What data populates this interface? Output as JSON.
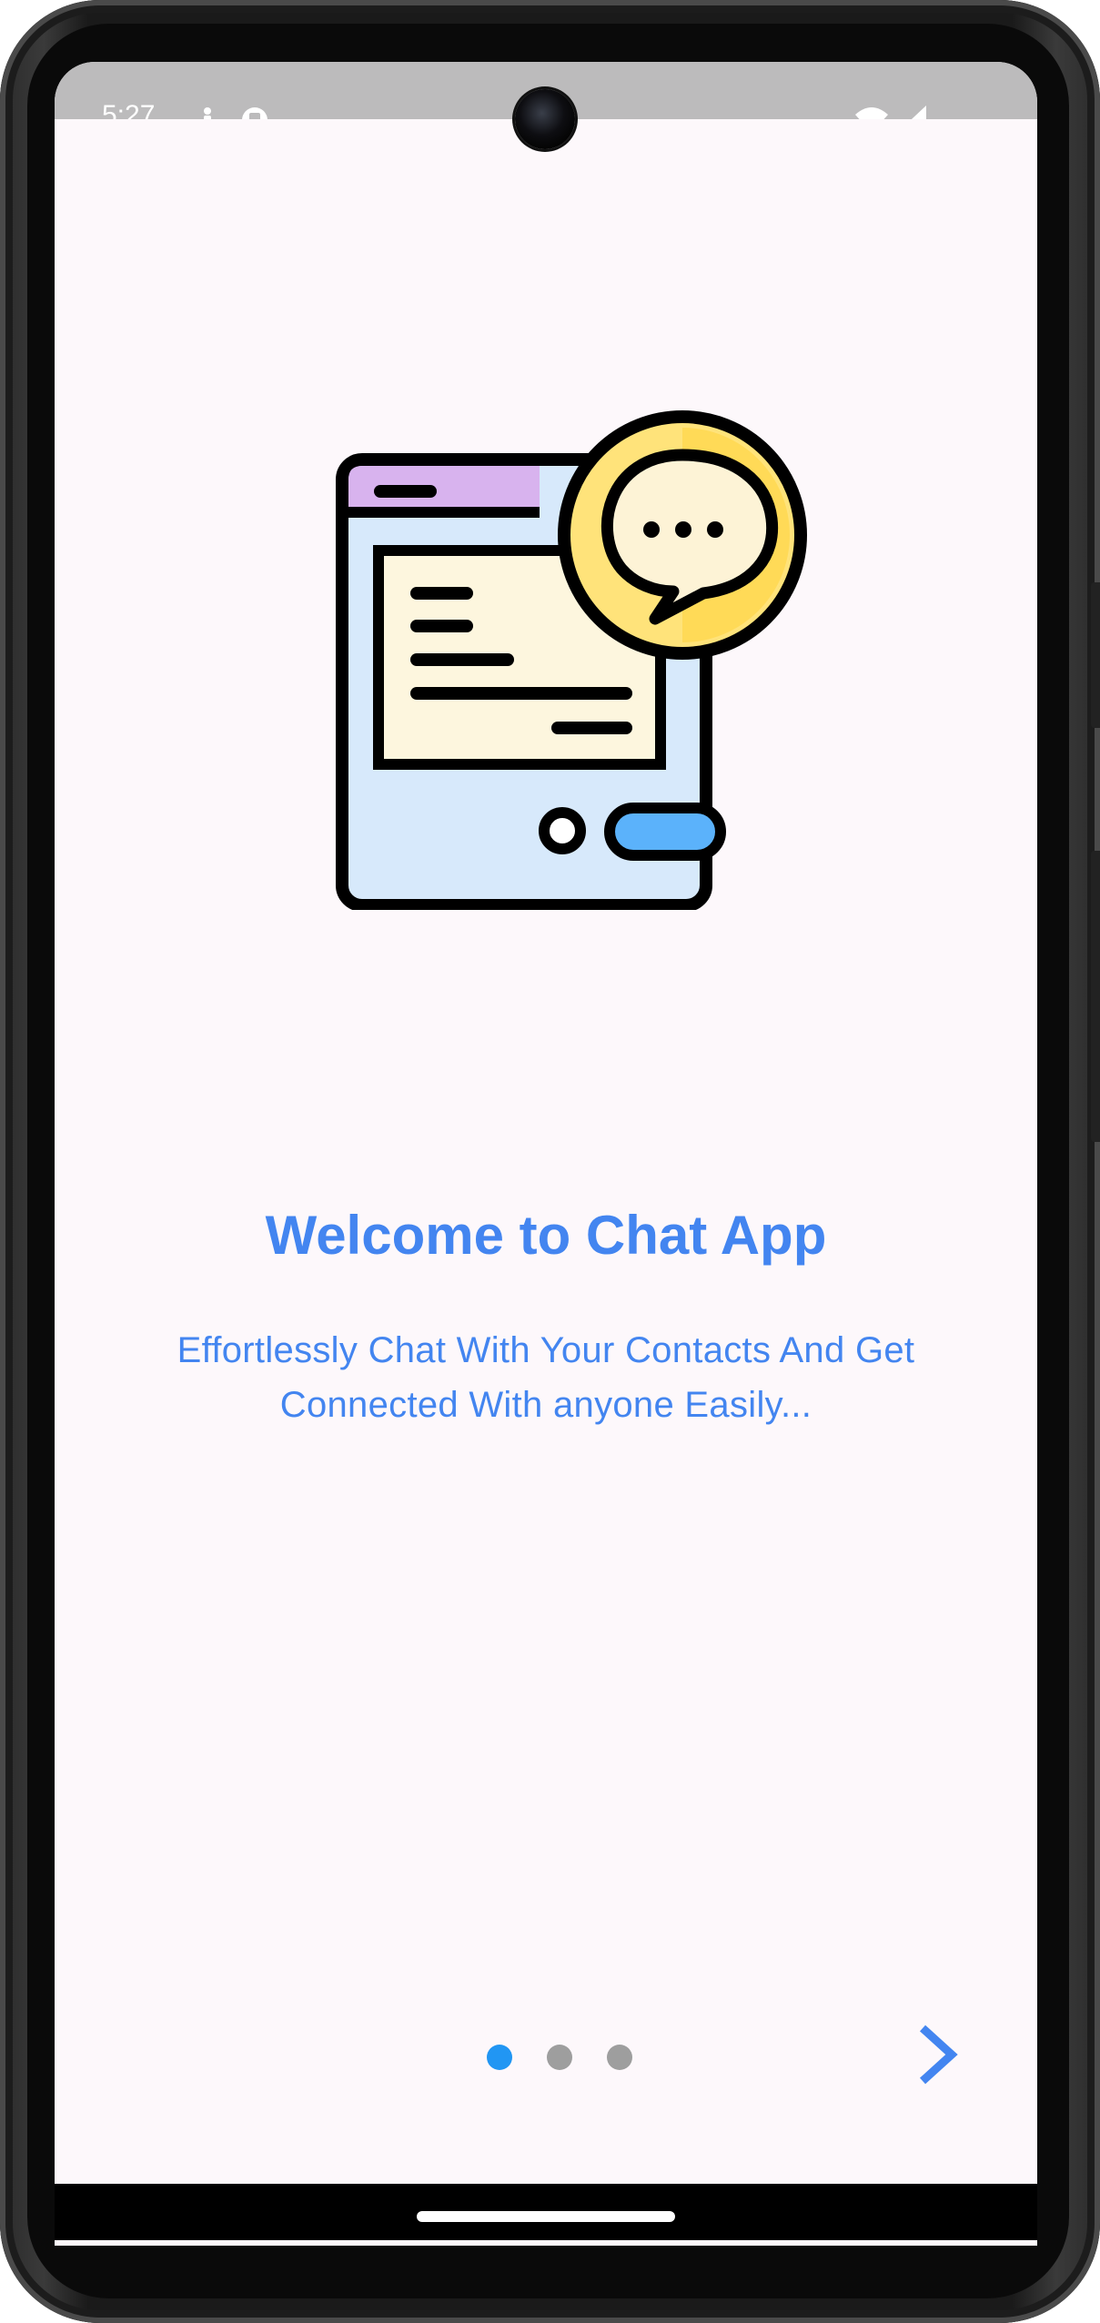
{
  "status_bar": {
    "time": "5:27",
    "icons_left": [
      "person-icon",
      "sim-icon"
    ],
    "icons_right": [
      "wifi-icon",
      "signal-icon"
    ]
  },
  "onboarding": {
    "illustration": "chat-app-illustration",
    "title": "Welcome to Chat App",
    "subtitle_line1": "Effortlessly Chat With Your Contacts And Get",
    "subtitle_line2": "Connected With anyone Easily...",
    "pages_total": 3,
    "current_page": 1,
    "next_icon": "chevron-right-icon"
  },
  "colors": {
    "accent": "#4385f0",
    "dot_active": "#2196f3",
    "dot_inactive": "#9e9e9e",
    "background": "#fdf8fb"
  }
}
